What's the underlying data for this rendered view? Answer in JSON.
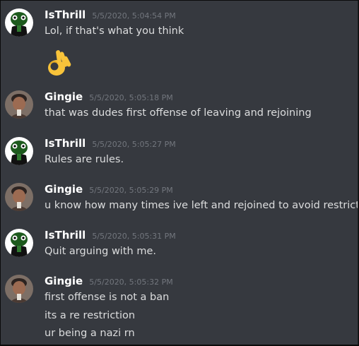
{
  "messages": [
    {
      "username": "IsThrill",
      "timestamp": "5/5/2020, 5:04:54 PM",
      "avatar": "isthrill-avatar",
      "lines": [
        "Lol, if that's what you think"
      ],
      "emoji": "ok-hand-emoji"
    },
    {
      "username": "Gingie",
      "timestamp": "5/5/2020, 5:05:18 PM",
      "avatar": "gingie-avatar",
      "lines": [
        "that was dudes first offense of leaving and rejoining"
      ]
    },
    {
      "username": "IsThrill",
      "timestamp": "5/5/2020, 5:05:27 PM",
      "avatar": "isthrill-avatar",
      "lines": [
        "Rules are rules."
      ]
    },
    {
      "username": "Gingie",
      "timestamp": "5/5/2020, 5:05:29 PM",
      "avatar": "gingie-avatar",
      "lines": [
        "u know how many times ive left and rejoined to avoid restriction"
      ]
    },
    {
      "username": "IsThrill",
      "timestamp": "5/5/2020, 5:05:31 PM",
      "avatar": "isthrill-avatar",
      "lines": [
        "Quit arguing with me."
      ]
    },
    {
      "username": "Gingie",
      "timestamp": "5/5/2020, 5:05:32 PM",
      "avatar": "gingie-avatar",
      "lines": [
        "first offense is not a ban",
        "its a re restriction",
        "ur being a nazi rn"
      ]
    }
  ],
  "colors": {
    "background": "#36393f",
    "username": "#ffffff",
    "timestamp": "#72767d",
    "message_text": "#dcddde"
  }
}
